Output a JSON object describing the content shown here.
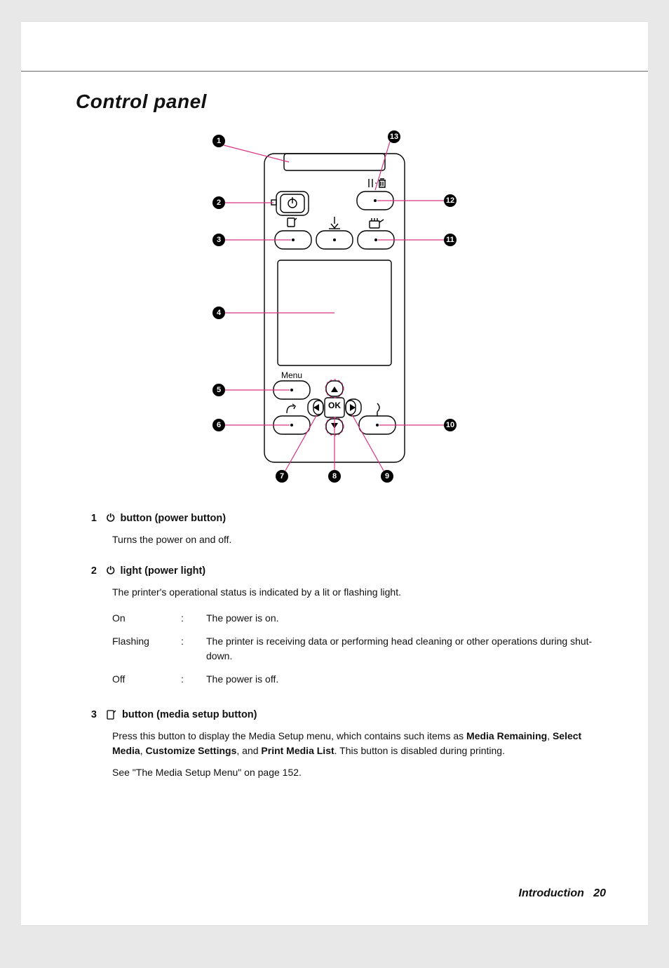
{
  "title": "Control panel",
  "diagram": {
    "callouts": [
      "1",
      "2",
      "3",
      "4",
      "5",
      "6",
      "7",
      "8",
      "9",
      "10",
      "11",
      "12",
      "13"
    ],
    "menuLabel": "Menu",
    "okLabel": "OK"
  },
  "items": [
    {
      "num": "1",
      "iconName": "power-icon",
      "iconGlyph": "⏻",
      "heading": "button (power button)",
      "paragraphs": [
        "Turns the power on and off."
      ],
      "statuses": [],
      "refText": ""
    },
    {
      "num": "2",
      "iconName": "power-icon",
      "iconGlyph": "⏻",
      "heading": "light (power light)",
      "paragraphs": [
        "The printer's operational status is indicated by a lit or flashing light."
      ],
      "statuses": [
        {
          "label": "On",
          "desc": "The power is on."
        },
        {
          "label": "Flashing",
          "desc": "The printer is receiving data or performing head cleaning or other operations during shut-down."
        },
        {
          "label": "Off",
          "desc": "The power is off."
        }
      ],
      "refText": ""
    },
    {
      "num": "3",
      "iconName": "media-icon",
      "iconGlyph": "📄",
      "heading": "button (media setup button)",
      "richParagraph": {
        "pre": "Press this button to display the Media Setup menu, which contains such items as ",
        "bold1": "Media Remaining",
        "sep1": ", ",
        "bold2": "Select Media",
        "sep2": ", ",
        "bold3": "Customize Settings",
        "sep3": ", and ",
        "bold4": "Print Media List",
        "post": ". This button is disabled during printing."
      },
      "refText": "See \"The Media Setup Menu\" on page 152.",
      "statuses": []
    }
  ],
  "footer": {
    "section": "Introduction",
    "page": "20"
  }
}
